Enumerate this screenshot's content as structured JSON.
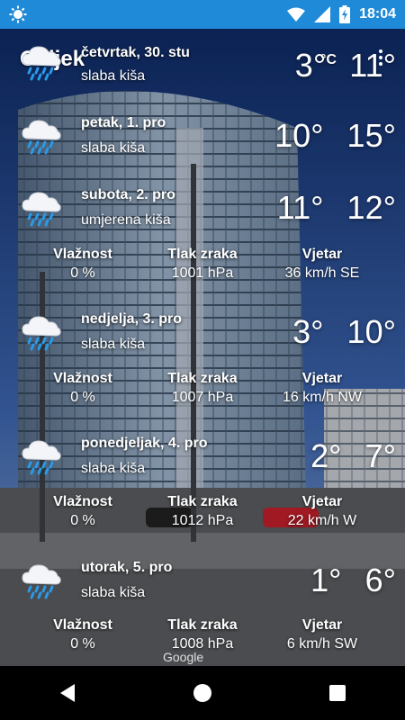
{
  "status_bar": {
    "time": "18:04",
    "icons": [
      "weather-app-icon",
      "wifi-icon",
      "signal-icon",
      "battery-charging-icon"
    ]
  },
  "header": {
    "city": "Osijek",
    "unit": "°C",
    "menu_icon": "overflow-menu-icon"
  },
  "labels": {
    "humidity": "Vlažnost",
    "pressure": "Tlak zraka",
    "wind": "Vjetar"
  },
  "days": [
    {
      "date": "četvrtak, 30. stu",
      "desc": "slaba kiša",
      "min": "3°",
      "max": "11°",
      "icon": "light-rain-cloud-icon"
    },
    {
      "date": "petak, 1. pro",
      "desc": "slaba kiša",
      "min": "10°",
      "max": "15°",
      "icon": "light-rain-cloud-icon"
    },
    {
      "date": "subota, 2. pro",
      "desc": "umjerena kiša",
      "min": "11°",
      "max": "12°",
      "icon": "rain-cloud-icon",
      "humidity": "0 %",
      "pressure": "1001 hPa",
      "wind": "36 km/h SE"
    },
    {
      "date": "nedjelja, 3. pro",
      "desc": "slaba kiša",
      "min": "3°",
      "max": "10°",
      "icon": "light-rain-cloud-icon",
      "humidity": "0 %",
      "pressure": "1007 hPa",
      "wind": "16 km/h NW"
    },
    {
      "date": "ponedjeljak, 4. pro",
      "desc": "slaba kiša",
      "min": "2°",
      "max": "7°",
      "icon": "light-rain-cloud-icon",
      "humidity": "0 %",
      "pressure": "1012 hPa",
      "wind": "22 km/h W"
    },
    {
      "date": "utorak, 5. pro",
      "desc": "slaba kiša",
      "min": "1°",
      "max": "6°",
      "icon": "light-rain-cloud-icon",
      "humidity": "0 %",
      "pressure": "1008 hPa",
      "wind": "6 km/h SW"
    }
  ],
  "attribution": "Google",
  "nav": {
    "back": "back-icon",
    "home": "home-icon",
    "recents": "recents-icon"
  },
  "colors": {
    "status_bar": "#1f8ad8",
    "nav_bar": "#000000",
    "rain_drop": "#2a9be8"
  }
}
